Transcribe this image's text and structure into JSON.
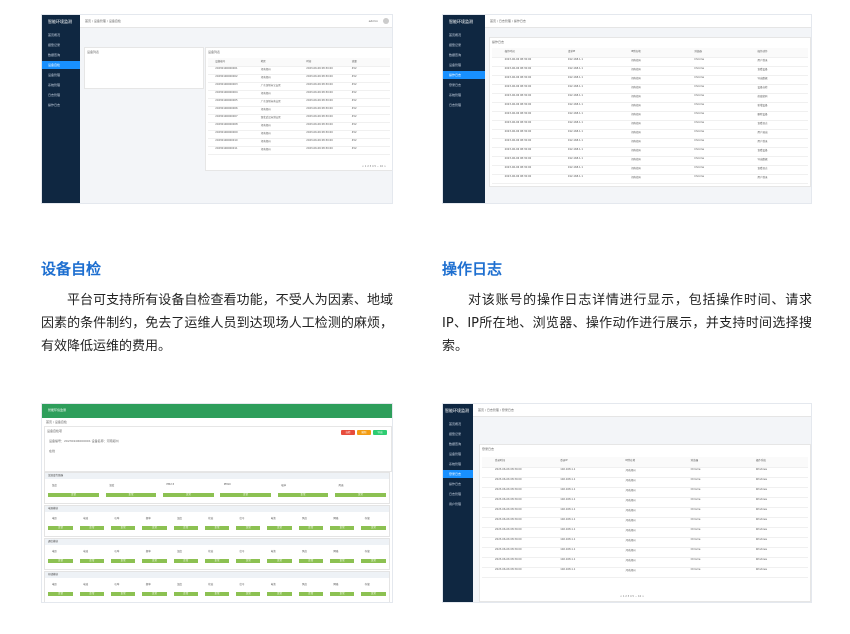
{
  "sections": [
    {
      "title": "设备自检",
      "desc": "平台可支持所有设备自检查看功能，不受人为因素、地域因素的条件制约，免去了运维人员到达现场人工检测的麻烦，有效降低运维的费用。"
    },
    {
      "title": "操作日志",
      "desc": "对该账号的操作日志详情进行显示，包括操作时间、请求IP、IP所在地、浏览器、操作动作进行展示，并支持时间选择搜索。"
    }
  ],
  "screens": {
    "s1": {
      "logo": "智能环境监测",
      "menu": [
        "首页概况",
        "报警记录",
        "数据查询",
        "设备自检",
        "设备管理",
        "系统管理",
        "日志管理",
        "操作日志"
      ],
      "active_index": 3,
      "breadcrumb": "首页 / 设备管理 / 设备自检",
      "user": "admin",
      "left_panel_title": "设备列表",
      "table_title": "设备列表",
      "columns": [
        "设备编号",
        "地区",
        "时间",
        "流量"
      ],
      "rows": [
        [
          "20230106000001",
          "河南郑州",
          "2023-06-06 08:30:00",
          "452"
        ],
        [
          "20230106000002",
          "河南郑州",
          "2023-06-06 08:30:00",
          "452"
        ],
        [
          "20230106000003",
          "广东深圳市宝安区",
          "2023-06-06 08:30:00",
          "452"
        ],
        [
          "20230106000004",
          "河南郑州",
          "2023-06-06 08:30:00",
          "452"
        ],
        [
          "20230106000005",
          "广东深圳市南山区",
          "2023-06-06 08:30:00",
          "452"
        ],
        [
          "20230106000006",
          "河南郑州",
          "2023-06-06 08:30:00",
          "452"
        ],
        [
          "20230106000007",
          "湖北武汉市洪山区",
          "2023-06-06 08:30:00",
          "452"
        ],
        [
          "20230106000008",
          "河南郑州",
          "2023-06-06 08:30:00",
          "452"
        ],
        [
          "20230106000009",
          "河南郑州",
          "2023-06-06 08:30:00",
          "452"
        ],
        [
          "20230106000010",
          "河南郑州",
          "2023-06-06 08:30:00",
          "452"
        ],
        [
          "20230106000011",
          "河南郑州",
          "2023-06-06 08:30:00",
          "452"
        ]
      ],
      "pager": "< 1 2 3 4 5 ... 10 >"
    },
    "s2": {
      "logo": "智能环境监测",
      "menu": [
        "首页概况",
        "报警记录",
        "数据查询",
        "设备管理",
        "操作日志",
        "登录日志",
        "系统管理",
        "日志管理"
      ],
      "active_index": 4,
      "breadcrumb": "首页 / 日志管理 / 操作日志",
      "panel_title": "操作日志",
      "columns": [
        "操作时间",
        "请求IP",
        "IP所在地",
        "浏览器",
        "操作动作"
      ],
      "rows": [
        [
          "2023-06-06 08:30:00",
          "192.168.1.1",
          "河南郑州",
          "Chrome",
          "用户登录"
        ],
        [
          "2023-06-06 08:30:00",
          "192.168.1.1",
          "河南郑州",
          "Chrome",
          "查看设备"
        ],
        [
          "2023-06-06 08:30:00",
          "192.168.1.1",
          "河南郑州",
          "Chrome",
          "导出数据"
        ],
        [
          "2023-06-06 08:30:00",
          "192.168.1.1",
          "河南郑州",
          "Chrome",
          "设备自检"
        ],
        [
          "2023-06-06 08:30:00",
          "192.168.1.1",
          "河南郑州",
          "Chrome",
          "修改密码"
        ],
        [
          "2023-06-06 08:30:00",
          "192.168.1.1",
          "河南郑州",
          "Chrome",
          "新增设备"
        ],
        [
          "2023-06-06 08:30:00",
          "192.168.1.1",
          "河南郑州",
          "Chrome",
          "删除设备"
        ],
        [
          "2023-06-06 08:30:00",
          "192.168.1.1",
          "河南郑州",
          "Chrome",
          "查看日志"
        ],
        [
          "2023-06-06 08:30:00",
          "192.168.1.1",
          "河南郑州",
          "Chrome",
          "用户退出"
        ],
        [
          "2023-06-06 08:30:00",
          "192.168.1.1",
          "河南郑州",
          "Chrome",
          "用户登录"
        ],
        [
          "2023-06-06 08:30:00",
          "192.168.1.1",
          "河南郑州",
          "Chrome",
          "查看设备"
        ],
        [
          "2023-06-06 08:30:00",
          "192.168.1.1",
          "河南郑州",
          "Chrome",
          "导出数据"
        ],
        [
          "2023-06-06 08:30:00",
          "192.168.1.1",
          "河南郑州",
          "Chrome",
          "查看日志"
        ],
        [
          "2023-06-06 08:30:00",
          "192.168.1.1",
          "河南郑州",
          "Chrome",
          "用户登录"
        ]
      ]
    },
    "s3": {
      "title": "智能环境监测",
      "breadcrumb": "首页 / 设备自检",
      "info": "设备编号：20230106000001  设备名称：河南郑州",
      "status": "在线",
      "group_title": "设备自检项",
      "groups": [
        {
          "name": "温湿度传感器",
          "cols": [
            "温度",
            "湿度",
            "PM2.5",
            "PM10",
            "噪声",
            "风速"
          ]
        },
        {
          "name": "电源模块",
          "cols": [
            "电压",
            "电流",
            "功率",
            "频率",
            "温度",
            "状态",
            "信号",
            "电池",
            "风扇",
            "网络",
            "存储"
          ]
        },
        {
          "name": "通信模块",
          "cols": [
            "电压",
            "电流",
            "功率",
            "频率",
            "温度",
            "状态",
            "信号",
            "电池",
            "风扇",
            "网络",
            "存储"
          ]
        },
        {
          "name": "存储模块",
          "cols": [
            "电压",
            "电流",
            "功率",
            "频率",
            "温度",
            "状态",
            "信号",
            "电池",
            "风扇",
            "网络",
            "存储"
          ]
        }
      ],
      "tag": "正常",
      "btn_labels": [
        "自检",
        "刷新",
        "导出"
      ],
      "btn_colors": [
        "#e74c3c",
        "#f39c12",
        "#2ecc71"
      ]
    },
    "s4": {
      "logo": "智能环境监测",
      "menu": [
        "首页概况",
        "报警记录",
        "数据查询",
        "设备管理",
        "系统管理",
        "登录日志",
        "操作日志",
        "日志管理",
        "用户管理"
      ],
      "active_index": 5,
      "breadcrumb": "首页 / 日志管理 / 登录日志",
      "panel_title": "登录日志",
      "columns": [
        "登录时间",
        "登录IP",
        "IP所在地",
        "浏览器",
        "操作系统"
      ],
      "rows": [
        [
          "2023-06-06 08:30:00",
          "192.168.1.1",
          "河南郑州",
          "Chrome",
          "Windows"
        ],
        [
          "2023-06-06 08:30:00",
          "192.168.1.1",
          "河南郑州",
          "Chrome",
          "Windows"
        ],
        [
          "2023-06-06 08:30:00",
          "192.168.1.1",
          "河南郑州",
          "Chrome",
          "Windows"
        ],
        [
          "2023-06-06 08:30:00",
          "192.168.1.1",
          "河南郑州",
          "Chrome",
          "Windows"
        ],
        [
          "2023-06-06 08:30:00",
          "192.168.1.1",
          "河南郑州",
          "Chrome",
          "Windows"
        ],
        [
          "2023-06-06 08:30:00",
          "192.168.1.1",
          "河南郑州",
          "Chrome",
          "Windows"
        ],
        [
          "2023-06-06 08:30:00",
          "192.168.1.1",
          "河南郑州",
          "Chrome",
          "Windows"
        ],
        [
          "2023-06-06 08:30:00",
          "192.168.1.1",
          "河南郑州",
          "Chrome",
          "Windows"
        ],
        [
          "2023-06-06 08:30:00",
          "192.168.1.1",
          "河南郑州",
          "Chrome",
          "Windows"
        ],
        [
          "2023-06-06 08:30:00",
          "192.168.1.1",
          "河南郑州",
          "Chrome",
          "Windows"
        ],
        [
          "2023-06-06 08:30:00",
          "192.168.1.1",
          "河南郑州",
          "Chrome",
          "Windows"
        ]
      ],
      "pager": "< 1 2 3 4 5 ... 10 >"
    }
  }
}
